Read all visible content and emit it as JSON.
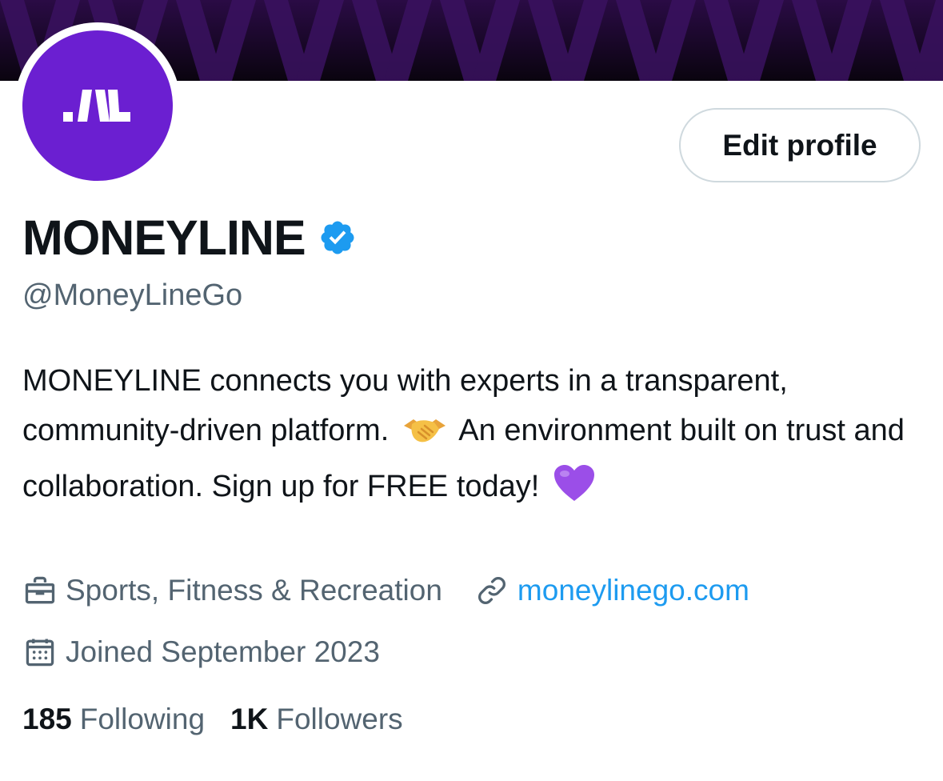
{
  "profile": {
    "display_name": "MONEYLINE",
    "handle": "@MoneyLineGo",
    "verified": true,
    "avatar_logo": "moneyline-logo",
    "bio": {
      "part1": "MONEYLINE connects you with experts in a transparent, community-driven platform.",
      "part2": "An environment built on trust and collaboration. Sign up for FREE today!",
      "emoji1": "handshake",
      "emoji2": "purple-heart"
    },
    "category": "Sports, Fitness & Recreation",
    "website": "moneylinego.com",
    "joined": "Joined September 2023",
    "following_count": "185",
    "following_label": "Following",
    "followers_count": "1K",
    "followers_label": "Followers"
  },
  "actions": {
    "edit_profile_label": "Edit profile"
  },
  "icons": {
    "category": "briefcase-icon",
    "website": "link-icon",
    "joined": "calendar-icon",
    "verified": "verified-badge-icon"
  },
  "colors": {
    "avatar_bg": "#6b1fd1",
    "banner_bg": "#120818",
    "link": "#1d9bf0",
    "verified": "#1d9bf0",
    "secondary_text": "#536471"
  }
}
